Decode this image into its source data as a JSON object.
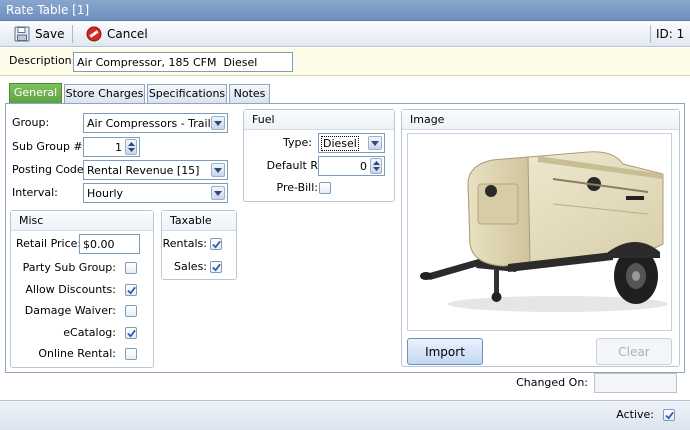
{
  "window": {
    "title": "Rate Table [1]"
  },
  "toolbar": {
    "save_label": "Save",
    "cancel_label": "Cancel",
    "id_label": "ID: 1"
  },
  "description": {
    "label": "Description:",
    "value": "Air Compressor, 185 CFM  Diesel"
  },
  "tabs": [
    {
      "label": "General",
      "active": true
    },
    {
      "label": "Store Charges"
    },
    {
      "label": "Specifications"
    },
    {
      "label": "Notes"
    }
  ],
  "general": {
    "group_label": "Group:",
    "group_value": "Air Compressors - Trail...",
    "subgroup_label": "Sub Group #:",
    "subgroup_value": "1",
    "posting_label": "Posting Code:",
    "posting_value": "Rental Revenue [15]",
    "interval_label": "Interval:",
    "interval_value": "Hourly"
  },
  "misc": {
    "title": "Misc",
    "retail_label": "Retail Price:",
    "retail_value": "$0.00",
    "party_label": "Party Sub Group:",
    "party_checked": false,
    "discounts_label": "Allow Discounts:",
    "discounts_checked": true,
    "damage_label": "Damage Waiver:",
    "damage_checked": false,
    "ecatalog_label": "eCatalog:",
    "ecatalog_checked": true,
    "online_label": "Online Rental:",
    "online_checked": false
  },
  "taxable": {
    "title": "Taxable",
    "rentals_label": "Rentals:",
    "rentals_checked": true,
    "sales_label": "Sales:",
    "sales_checked": true
  },
  "fuel": {
    "title": "Fuel",
    "type_label": "Type:",
    "type_value": "Diesel",
    "refill_label": "Default Refill:",
    "refill_value": "0",
    "prebill_label": "Pre-Bill:",
    "prebill_checked": false
  },
  "image": {
    "title": "Image",
    "import_label": "Import",
    "clear_label": "Clear"
  },
  "changed_on": {
    "label": "Changed On:",
    "value": ""
  },
  "status": {
    "active_label": "Active:",
    "active_checked": true
  },
  "colors": {
    "accent_tab": "#5aa23e",
    "titlebar": "#7b98c6",
    "check": "#2a5db0",
    "description_bg": "#fdfce8"
  }
}
